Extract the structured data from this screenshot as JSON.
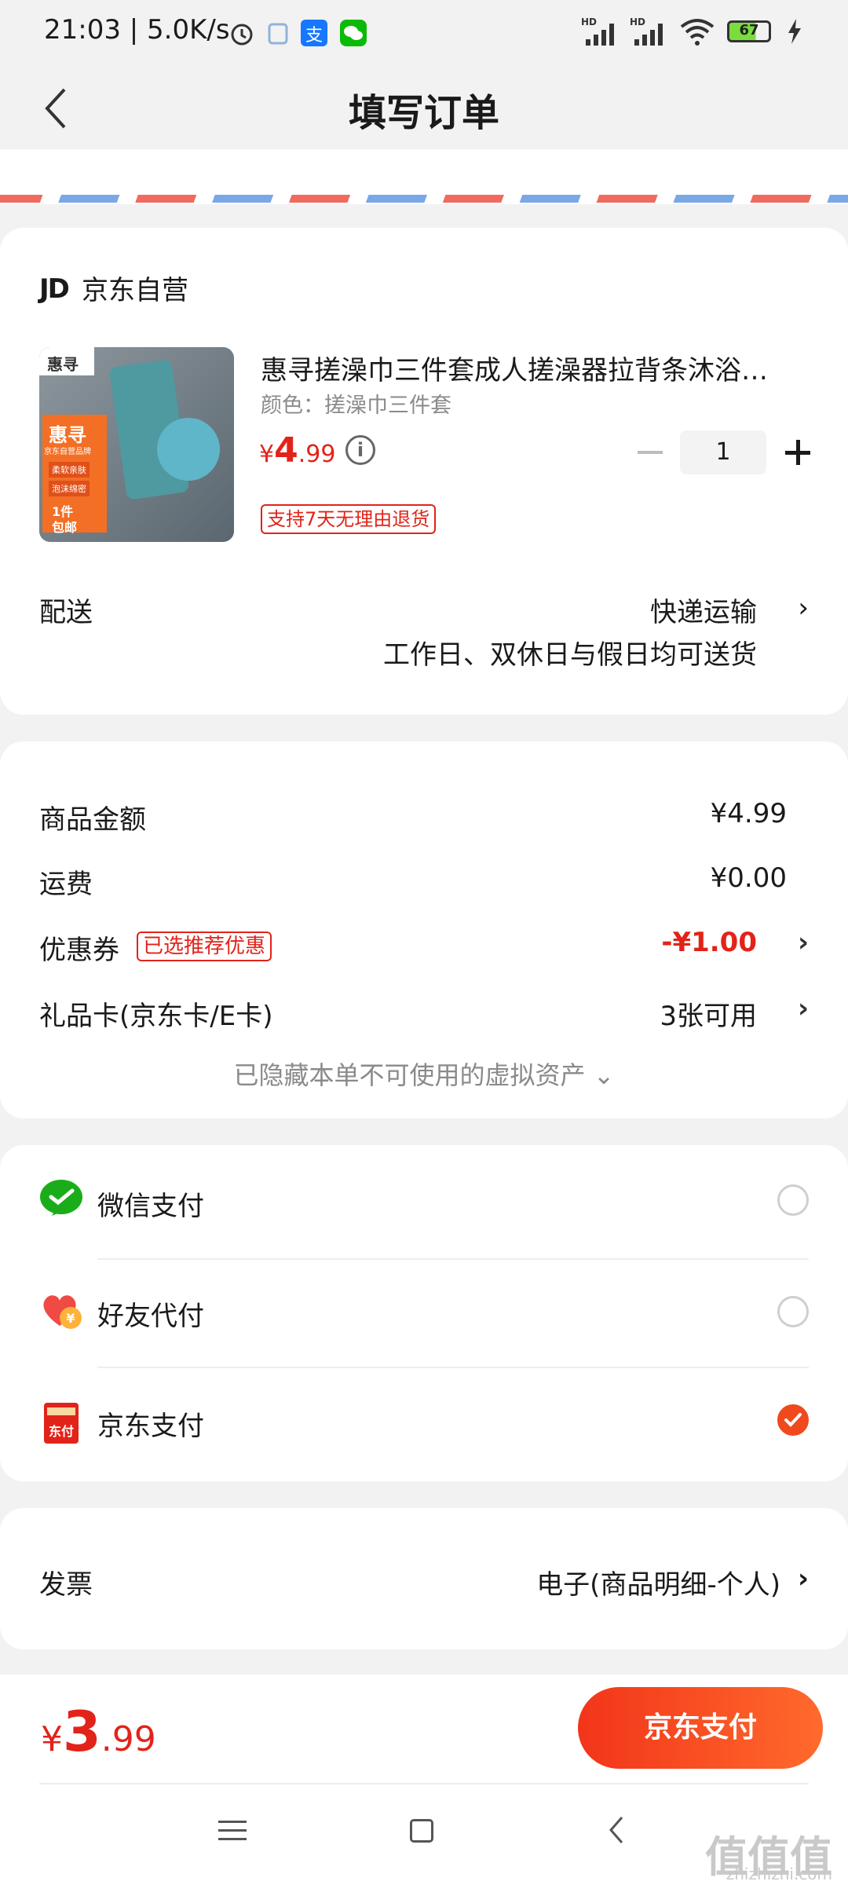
{
  "status_bar": {
    "time": "21:03 | 5.0K/s",
    "battery": "67",
    "icons": [
      "alarm-icon",
      "app-icon",
      "alipay-icon",
      "wechat-icon",
      "signal-hd-icon",
      "signal-hd-icon",
      "wifi-icon",
      "battery-icon",
      "charging-icon"
    ]
  },
  "header": {
    "title": "填写订单"
  },
  "shop": {
    "logo": "JD",
    "name": "京东自营"
  },
  "product": {
    "title": "惠寻搓澡巾三件套成人搓澡器拉背条沐浴…",
    "color": "颜色：搓澡巾三件套",
    "price_symbol": "¥",
    "price_int": "4",
    "price_dec": ".99",
    "quantity": "1",
    "return_tag": "支持7天无理由退货",
    "image_text": {
      "brand": "惠寻",
      "line1": "惠寻",
      "line2": "京东自营品牌",
      "line3": "柔软亲肤",
      "line4": "泡沫绵密",
      "line5": "1件",
      "line6": "包邮"
    }
  },
  "delivery": {
    "label": "配送",
    "method": "快递运输",
    "note": "工作日、双休日与假日均可送货"
  },
  "amounts": {
    "goods_label": "商品金额",
    "goods_value": "¥4.99",
    "shipping_label": "运费",
    "shipping_value": "¥0.00",
    "coupon_label": "优惠券",
    "coupon_tag": "已选推荐优惠",
    "coupon_value": "-¥1.00",
    "giftcard_label": "礼品卡(京东卡/E卡)",
    "giftcard_value": "3张可用",
    "hidden_assets": "已隐藏本单不可使用的虚拟资产 ⌄"
  },
  "payment": {
    "options": [
      {
        "label": "微信支付",
        "icon": "wechat-pay-icon",
        "selected": false
      },
      {
        "label": "好友代付",
        "icon": "friend-pay-icon",
        "selected": false
      },
      {
        "label": "京东支付",
        "icon": "jd-pay-icon",
        "selected": true
      }
    ]
  },
  "invoice": {
    "label": "发票",
    "value": "电子(商品明细-个人)"
  },
  "bottom": {
    "total_symbol": "¥",
    "total_int": "3",
    "total_dec": ".99",
    "pay_button": "京东支付"
  },
  "watermark": {
    "text": "值值值",
    "url": "zhizhizhi.com"
  },
  "colors": {
    "accent": "#e2231a",
    "button_start": "#f2351a",
    "button_end": "#ff6a2c",
    "background": "#f2f2f2"
  }
}
